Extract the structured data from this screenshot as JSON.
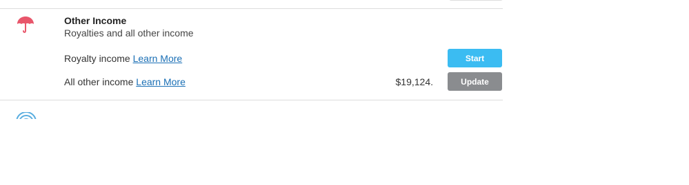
{
  "section": {
    "title": "Other Income",
    "subtitle": "Royalties and all other income",
    "icon": "umbrella-icon",
    "icon_color": "#e8566b"
  },
  "rows": [
    {
      "label": "Royalty income",
      "link": "Learn More",
      "amount": "",
      "button": "Start",
      "button_color": "#3bbcf2"
    },
    {
      "label": "All other income",
      "link": "Learn More",
      "amount": "$19,124.",
      "button": "Update",
      "button_color": "#8a8c8f"
    }
  ],
  "next_section": {
    "icon": "signal-icon",
    "icon_color": "#5aaee0"
  },
  "colors": {
    "link": "#1a6fb5",
    "divider": "#dcdcdc"
  }
}
